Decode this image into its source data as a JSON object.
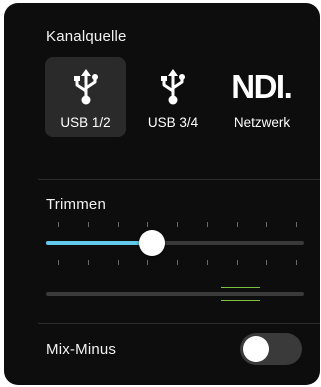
{
  "channel_source": {
    "label": "Kanalquelle",
    "options": [
      {
        "label": "USB 1/2",
        "icon": "usb-icon",
        "selected": true
      },
      {
        "label": "USB 3/4",
        "icon": "usb-icon",
        "selected": false
      },
      {
        "label": "Netzwerk",
        "icon": "ndi-logo",
        "logo_text": "NDI",
        "selected": false
      }
    ]
  },
  "trim": {
    "label": "Trimmen",
    "value_fraction": 0.41,
    "tick_count": 9,
    "accent_color": "#63c9ec",
    "level_indicator": {
      "start_fraction": 0.68,
      "end_fraction": 0.83,
      "color": "#7bbf3f"
    }
  },
  "mix_minus": {
    "label": "Mix-Minus",
    "enabled": false
  }
}
